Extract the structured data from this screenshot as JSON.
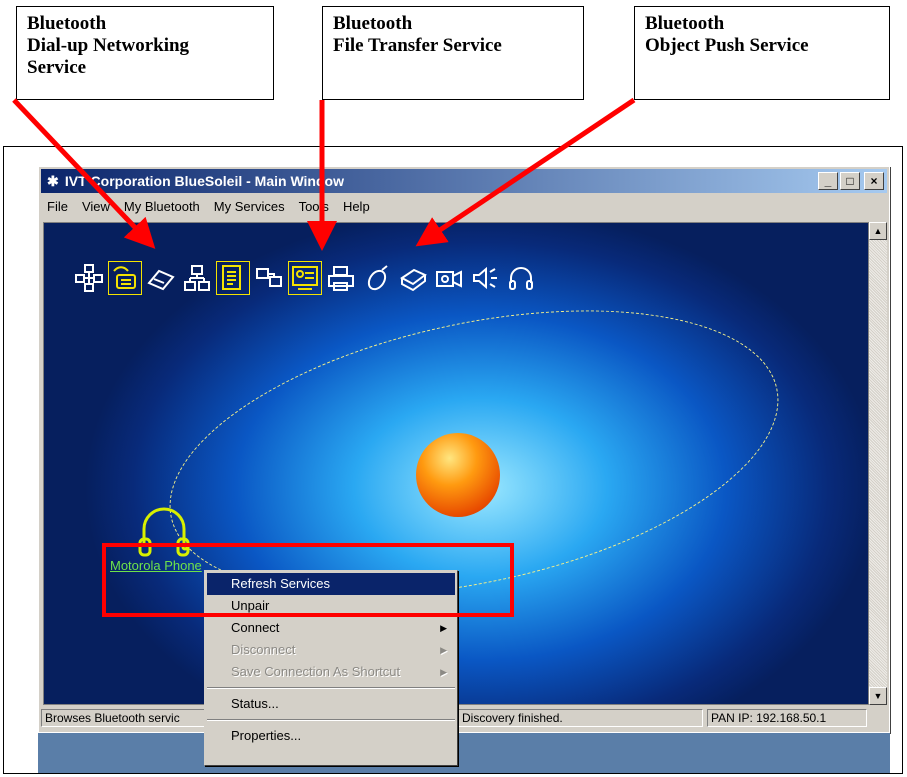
{
  "callouts": [
    {
      "line1": "Bluetooth",
      "line2": "Dial-up Networking",
      "line3": "Service"
    },
    {
      "line1": "Bluetooth",
      "line2": "File Transfer Service"
    },
    {
      "line1": "Bluetooth",
      "line2": "Object Push Service"
    }
  ],
  "window": {
    "title": "IVT Corporation BlueSoleil - Main Window",
    "minimize": "_",
    "maximize": "□",
    "close": "×"
  },
  "menubar": [
    "File",
    "View",
    "My Bluetooth",
    "My Services",
    "Tools",
    "Help"
  ],
  "services": [
    {
      "icon": "network-access-icon",
      "selected": false
    },
    {
      "icon": "dial-up-networking-icon",
      "selected": true
    },
    {
      "icon": "fax-icon",
      "selected": false
    },
    {
      "icon": "lan-access-icon",
      "selected": false
    },
    {
      "icon": "file-transfer-icon",
      "selected": true
    },
    {
      "icon": "personal-area-network-icon",
      "selected": false
    },
    {
      "icon": "object-push-icon",
      "selected": true
    },
    {
      "icon": "printer-icon",
      "selected": false
    },
    {
      "icon": "mouse-icon",
      "selected": false
    },
    {
      "icon": "fax-machine-icon",
      "selected": false
    },
    {
      "icon": "camera-icon",
      "selected": false
    },
    {
      "icon": "speaker-icon",
      "selected": false
    },
    {
      "icon": "headset-icon",
      "selected": false
    }
  ],
  "device": {
    "label": "Motorola Phone",
    "icon": "headset-icon"
  },
  "context_menu": {
    "refresh": "Refresh Services",
    "unpair": "Unpair",
    "connect": "Connect",
    "disconnect": "Disconnect",
    "save_shortcut": "Save Connection As Shortcut",
    "status": "Status...",
    "properties": "Properties..."
  },
  "statusbar": {
    "left": "Browses Bluetooth servic",
    "middle": "e Discovery finished.",
    "right": "PAN IP: 192.168.50.1"
  },
  "colors": {
    "annotation_red": "#ff0000",
    "title_bar": "#0a246a",
    "device_label": "#6ee24a",
    "selection": "#f4e300"
  }
}
